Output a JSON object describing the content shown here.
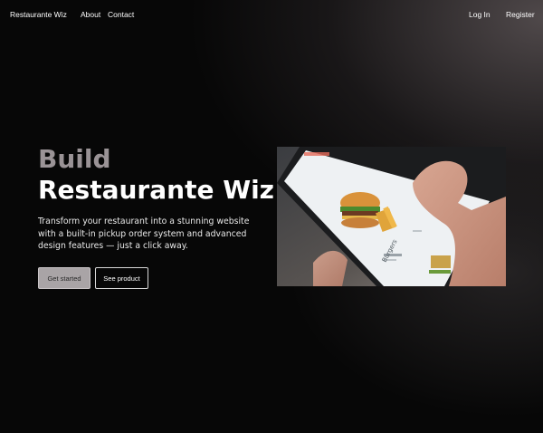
{
  "nav": {
    "brand": "Restaurante Wiz",
    "links": [
      "About",
      "Contact"
    ],
    "login": "Log In",
    "register": "Register"
  },
  "hero": {
    "title_line1": "Build",
    "title_line2": "Restaurante Wiz",
    "subtitle": "Transform your restaurant into a stunning website with a built-in pickup order system and advanced design features — just a click away.",
    "primary_button": "Get started",
    "secondary_button": "See product",
    "image_label": "Burgers"
  },
  "colors": {
    "background": "#070707",
    "title_muted": "#9a9396",
    "primary_button_bg": "#a9a4a6"
  }
}
